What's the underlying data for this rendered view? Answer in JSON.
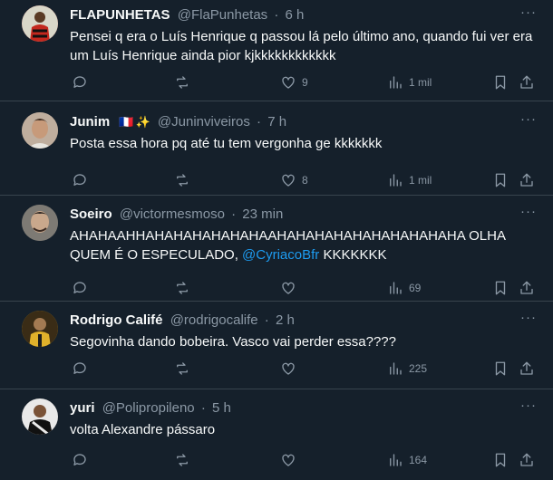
{
  "tweets": [
    {
      "name": "FLAPUNHETAS",
      "handle": "@FlaPunhetas",
      "time": "6 h",
      "text": "Pensei q era o Luís Henrique q passou lá pelo último ano, quando fui ver era um Luís Henrique ainda pior kjkkkkkkkkkkkk",
      "likes": "9",
      "views": "1 mil",
      "avatar_color": "#c3281e"
    },
    {
      "name": "Junim",
      "handle": "@Juninviveiros",
      "time": "7 h",
      "badges": "🇫🇷",
      "sparkle": "✨",
      "text": "Posta essa hora pq até tu tem vergonha ge kkkkkkk",
      "likes": "8",
      "views": "1 mil",
      "avatar_color": "#a98d78"
    },
    {
      "name": "Soeiro",
      "handle": "@victormesmoso",
      "time": "23 min",
      "text_part1": "AHAHAAHHAHAHAHAHAHAHAAHAHAHAHAHAHAHAHAHAHA OLHA QUEM É O ESPECULADO, ",
      "mention": "@CyriacoBfr",
      "text_part2": " KKKKKKK",
      "likes": "",
      "views": "69",
      "avatar_color": "#6d6a64"
    },
    {
      "name": "Rodrigo Califé",
      "handle": "@rodrigocalife",
      "time": "2 h",
      "text": "Segovinha dando bobeira.  Vasco vai perder essa????",
      "likes": "",
      "views": "225",
      "avatar_color": "#d8a21e"
    },
    {
      "name": "yuri",
      "handle": "@Polipropileno",
      "time": "5 h",
      "text": "volta Alexandre pássaro",
      "likes": "",
      "views": "164",
      "avatar_color": "#2b2b2b"
    }
  ],
  "separator": "·",
  "more_icon": "···"
}
